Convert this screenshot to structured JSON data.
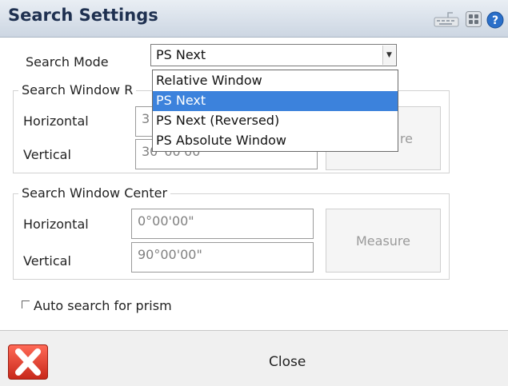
{
  "titlebar": {
    "title": "Search Settings",
    "icons": [
      "keyboard-icon",
      "apps-icon",
      "help-icon"
    ]
  },
  "search_mode": {
    "label": "Search Mode",
    "value": "PS Next",
    "options": [
      "Relative Window",
      "PS Next",
      "PS Next (Reversed)",
      "PS Absolute Window"
    ],
    "selected": "PS Next"
  },
  "search_window_range": {
    "title": "Search Window R",
    "horizontal_label": "Horizontal",
    "horizontal_value": "3",
    "vertical_label": "Vertical",
    "vertical_value": "30°00'00\"",
    "measure_label": "re"
  },
  "search_window_center": {
    "title": "Search Window Center",
    "horizontal_label": "Horizontal",
    "horizontal_value": "0°00'00\"",
    "vertical_label": "Vertical",
    "vertical_value": "90°00'00\"",
    "measure_label": "Measure"
  },
  "auto_search": {
    "label": "Auto search for prism",
    "checked": false
  },
  "footer": {
    "close_label": "Close"
  },
  "colors": {
    "titlebar_text": "#1e3050",
    "dropdown_selection": "#3c82dc",
    "close_button": "#e23a2a"
  }
}
